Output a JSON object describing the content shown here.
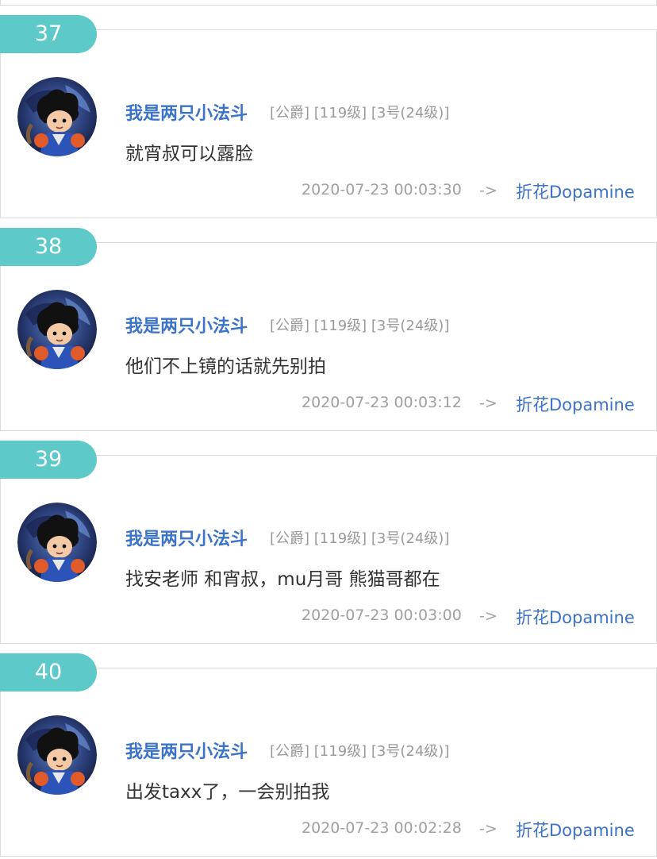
{
  "posts": [
    {
      "floor": "37",
      "username": "我是两只小法斗",
      "meta": "[公爵] [119级] [3号(24级)]",
      "content": "就宵叔可以露脸",
      "timestamp": "2020-07-23 00:03:30",
      "arrow": "->",
      "reply_to": "折花Dopamine"
    },
    {
      "floor": "38",
      "username": "我是两只小法斗",
      "meta": "[公爵] [119级] [3号(24级)]",
      "content": "他们不上镜的话就先别拍",
      "timestamp": "2020-07-23 00:03:12",
      "arrow": "->",
      "reply_to": "折花Dopamine"
    },
    {
      "floor": "39",
      "username": "我是两只小法斗",
      "meta": "[公爵] [119级] [3号(24级)]",
      "content": "找安老师 和宵叔，mu月哥 熊猫哥都在",
      "timestamp": "2020-07-23 00:03:00",
      "arrow": "->",
      "reply_to": "折花Dopamine"
    },
    {
      "floor": "40",
      "username": "我是两只小法斗",
      "meta": "[公爵] [119级] [3号(24级)]",
      "content": "出发taxx了，一会别拍我",
      "timestamp": "2020-07-23 00:02:28",
      "arrow": "->",
      "reply_to": "折花Dopamine"
    }
  ],
  "colors": {
    "badge": "#5dc9c9",
    "username": "#3a73c9",
    "link": "#3a73c9",
    "meta": "#9a9a9a",
    "content": "#333333",
    "border": "#dcdcdc"
  },
  "icons": {
    "avatar": "avatar-icon"
  }
}
